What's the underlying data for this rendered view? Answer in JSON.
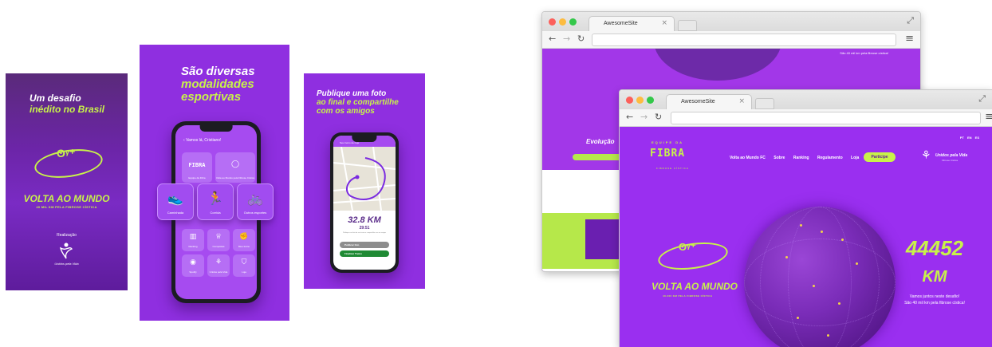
{
  "panel1": {
    "title_line1": "Um desafio",
    "title_line2": "inédito no Brasil",
    "lungs_icon": "lungs-icon",
    "brand_title": "VOLTA AO MUNDO",
    "brand_subtitle": "40 MIL KM PELA FIBROSE CÍSTICA",
    "realizacao_label": "Realização",
    "org_name": "Unidos pela Vida"
  },
  "panel2": {
    "title_line1": "São diversas",
    "title_line2": "modalidades",
    "title_line3": "esportivas",
    "screen_header": "Vamos lá, Cristiano!",
    "small_tiles_top": [
      {
        "icon": "equipe-fibra-icon",
        "label": "Equipe da Fibra"
      },
      {
        "icon": "volta-ao-mundo-icon",
        "label": "Volta ao Mundo pela Fibrose Cística"
      }
    ],
    "big_tiles": [
      {
        "icon": "sneaker-icon",
        "label": "Caminhada"
      },
      {
        "icon": "running-shoe-icon",
        "label": "Corrida"
      },
      {
        "icon": "bicycle-icon",
        "label": "Outros esportes"
      }
    ],
    "small_tiles_bottom": [
      {
        "icon": "ranking-icon",
        "label": "Ranking"
      },
      {
        "icon": "trophy-icon",
        "label": "Conquistas"
      },
      {
        "icon": "muscle-icon",
        "label": "Meu treino"
      },
      {
        "icon": "spotify-icon",
        "label": "Spotify"
      },
      {
        "icon": "unidos-pela-vida-icon",
        "label": "Unidos pela Vida"
      },
      {
        "icon": "shopping-bag-icon",
        "label": "Loja"
      }
    ]
  },
  "panel3": {
    "title_line1": "Publique uma foto",
    "title_line2": "ao final e compartilhe",
    "title_line3": "com os amigos",
    "map_header": "Seu treino de hoje",
    "distance": "32.8 KM",
    "time": "29:51",
    "note": "Publique sua foto do seu treino e compartilhe com os amigos",
    "btn_publish": "Publicar foto",
    "btn_finish": "Finalizar Treino"
  },
  "browser_back": {
    "tab_title": "AwesomeSite",
    "evolucao_label": "Evolução",
    "note": "São 40 mil km pela fibrose cística!"
  },
  "browser_front": {
    "tab_title": "AwesomeSite",
    "languages": [
      "PT",
      "EN",
      "ES"
    ],
    "brand_top": "EQUIPE DA",
    "brand_name": "FIBRA",
    "brand_sub": "FIBROSE CÍSTICA",
    "nav_items": [
      "Volta ao Mundo FC",
      "Sobre",
      "Ranking",
      "Regulamento",
      "Loja"
    ],
    "cta_label": "Participe",
    "org_name": "Unidos pela Vida",
    "org_sub": "Fibrose Cística",
    "hero_title": "VOLTA AO MUNDO",
    "hero_subtitle": "40.000 KM PELA FIBROSE CÍSTICA",
    "km_value": "44452",
    "km_unit": "KM",
    "tagline_1": "Vamos juntos neste desafio!",
    "tagline_2": "São 40 mil km pela fibrose cística!"
  },
  "colors": {
    "purple": "#9a2ff0",
    "lime": "#c8f24a",
    "dark_purple": "#5a1a90"
  }
}
